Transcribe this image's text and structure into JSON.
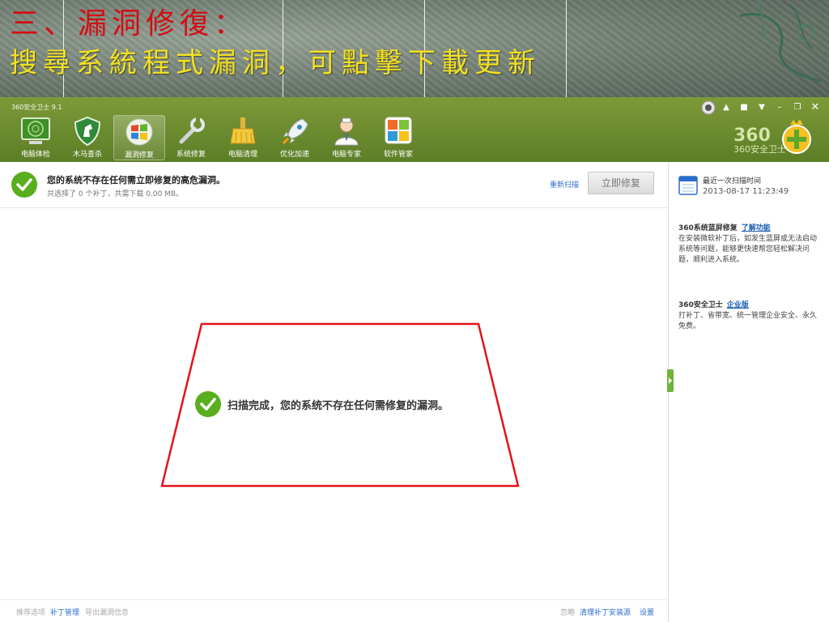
{
  "slide": {
    "title_line1": "三、漏洞修復：",
    "title_line2": "搜尋系統程式漏洞，可點擊下載更新"
  },
  "app": {
    "title": "360安全卫士 9.1",
    "nav": [
      {
        "label": "电脑体检",
        "icon": "radar-screen-icon"
      },
      {
        "label": "木马查杀",
        "icon": "horse-shield-icon"
      },
      {
        "label": "漏洞修复",
        "icon": "windows-patch-icon",
        "active": true
      },
      {
        "label": "系统修复",
        "icon": "wrench-icon"
      },
      {
        "label": "电脑清理",
        "icon": "broom-icon"
      },
      {
        "label": "优化加速",
        "icon": "rocket-icon"
      },
      {
        "label": "电脑专家",
        "icon": "doctor-icon"
      },
      {
        "label": "软件管家",
        "icon": "software-grid-icon"
      }
    ],
    "logo_text": "360安全卫士"
  },
  "status": {
    "main": "您的系统不存在任何需立即修复的高危漏洞。",
    "sub": "共选择了 0 个补丁，共需下载 0.00 MB。",
    "rescan": "重新扫描",
    "fix_now": "立即修复"
  },
  "result": {
    "message": "扫描完成，您的系统不存在任何需修复的漏洞。"
  },
  "footer": {
    "recommend": "推荐选项",
    "patch_manage": "补丁管理",
    "export": "导出漏洞信息",
    "ignore": "忽略",
    "clean": "清理补丁安装源",
    "settings": "设置"
  },
  "sidebar": {
    "last_scan_label": "最近一次扫描时间",
    "last_scan_time": "2013-08-17 11:23:49",
    "bsod_title": "360系统蓝屏修复",
    "bsod_link": "了解功能",
    "bsod_desc": "在安装微软补丁后，如发生蓝屏或无法启动系统等问题，能够更快速帮您轻松解决问题，顺利进入系统。",
    "enterprise_title": "360安全卫士",
    "enterprise_link": "企业版",
    "enterprise_desc": "打补丁、省带宽、统一管理企业安全、永久免费。"
  },
  "colors": {
    "toolbar_green": "#6e8f2f",
    "check_green": "#58ae1c",
    "link_blue": "#2a6fc9",
    "annotation_red": "#e0141a"
  }
}
